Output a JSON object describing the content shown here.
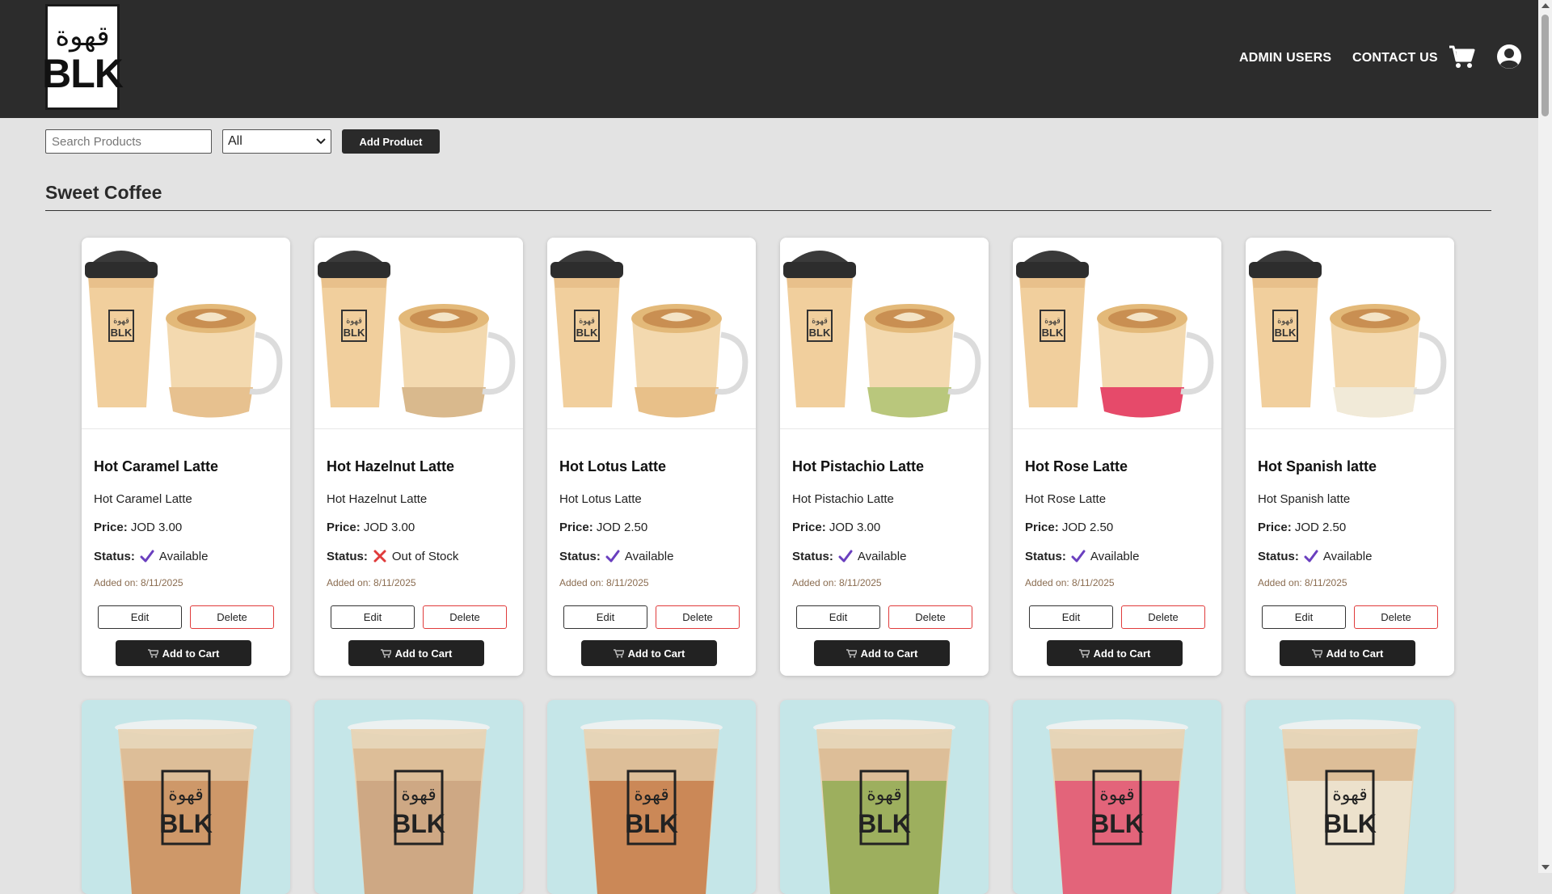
{
  "header": {
    "logo_arabic": "قهوة",
    "logo_text": "BLK",
    "nav": {
      "admin_users": "ADMIN USERS",
      "contact_us": "CONTACT US"
    },
    "icons": {
      "cart": "cart-icon",
      "account": "user-circle-icon"
    }
  },
  "toolbar": {
    "search_placeholder": "Search Products",
    "filter_value": "All",
    "add_product_label": "Add Product"
  },
  "section": {
    "title": "Sweet Coffee"
  },
  "labels": {
    "price": "Price:",
    "status": "Status:",
    "edit": "Edit",
    "delete": "Delete",
    "add_to_cart": "Add to Cart"
  },
  "colors": {
    "header_bg": "#2c2c2c",
    "available_check": "#6a3fbf",
    "out_of_stock_x": "#e03b3b",
    "delete_border": "#e03b3b"
  },
  "products": [
    {
      "title": "Hot Caramel Latte",
      "description": "Hot Caramel Latte",
      "price": "JOD 3.00",
      "status": "Available",
      "in_stock": true,
      "added": "Added on: 8/11/2025",
      "layer_color": "#e7c18f"
    },
    {
      "title": "Hot Hazelnut Latte",
      "description": "Hot Hazelnut Latte",
      "price": "JOD 3.00",
      "status": "Out of Stock",
      "in_stock": false,
      "added": "Added on: 8/11/2025",
      "layer_color": "#d9b98d"
    },
    {
      "title": "Hot Lotus Latte",
      "description": "Hot Lotus Latte",
      "price": "JOD 2.50",
      "status": "Available",
      "in_stock": true,
      "added": "Added on: 8/11/2025",
      "layer_color": "#e8c089"
    },
    {
      "title": "Hot Pistachio Latte",
      "description": "Hot Pistachio Latte",
      "price": "JOD 3.00",
      "status": "Available",
      "in_stock": true,
      "added": "Added on: 8/11/2025",
      "layer_color": "#b9c77c"
    },
    {
      "title": "Hot Rose Latte",
      "description": "Hot Rose Latte",
      "price": "JOD 2.50",
      "status": "Available",
      "in_stock": true,
      "added": "Added on: 8/11/2025",
      "layer_color": "#e64a6a"
    },
    {
      "title": "Hot Spanish latte",
      "description": "Hot Spanish latte",
      "price": "JOD 2.50",
      "status": "Available",
      "in_stock": true,
      "added": "Added on: 8/11/2025",
      "layer_color": "#f1ead8"
    }
  ],
  "row2_layers": [
    "#c98d5a",
    "#c9a07a",
    "#c57a45",
    "#8fa84e",
    "#e2506e",
    "#ece3cf"
  ]
}
